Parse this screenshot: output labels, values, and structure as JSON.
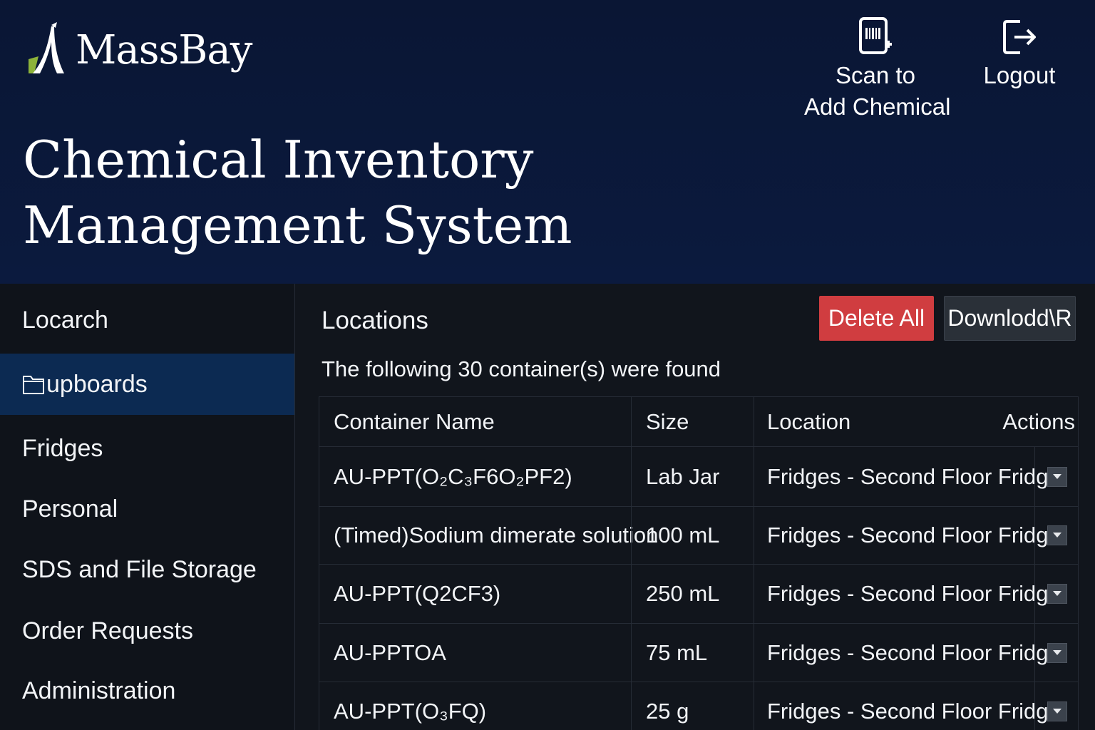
{
  "header": {
    "brand": "MassBay",
    "title_line1": "Chemical Inventory",
    "title_line2": "Management System",
    "scan_line1": "Scan to",
    "scan_line2": "Add Chemical",
    "logout": "Logout"
  },
  "sidebar": {
    "items": [
      {
        "label": "Locarch"
      },
      {
        "label": "upboards",
        "icon": "folder-icon",
        "active": true
      },
      {
        "label": "Fridges"
      },
      {
        "label": "Personal"
      },
      {
        "label": "SDS and File Storage"
      },
      {
        "label": "Order Requests"
      },
      {
        "label": "Administration"
      }
    ]
  },
  "main": {
    "section_title": "Locations",
    "delete_all": "Delete All",
    "download": "Downlodd\\R",
    "found_text": "The following 30 container(s) were found",
    "columns": {
      "name": "Container Name",
      "size": "Size",
      "location": "Location",
      "actions": "Actions"
    },
    "rows": [
      {
        "name": "AU-PPT(O₂C₃F6O₂PF2)",
        "size": "Lab Jar",
        "location": "Fridges - Second Floor Fridge"
      },
      {
        "name": "(Timed)Sodium dimerate solution",
        "size": "100 mL",
        "location": "Fridges - Second Floor Fridge"
      },
      {
        "name": "AU-PPT(Q2CF3)",
        "size": "250 mL",
        "location": "Fridges - Second Floor Fridge"
      },
      {
        "name": "AU-PPTOA",
        "size": "75 mL",
        "location": "Fridges - Second Floor Fridge"
      },
      {
        "name": "AU-PPT(O₃FQ)",
        "size": "25 g",
        "location": "Fridges - Second Floor Fridge"
      }
    ]
  },
  "colors": {
    "header_bg": "#0b1a3e",
    "active_bg": "#0c2a52",
    "danger": "#d03d40",
    "logo_accent": "#8db33a"
  }
}
